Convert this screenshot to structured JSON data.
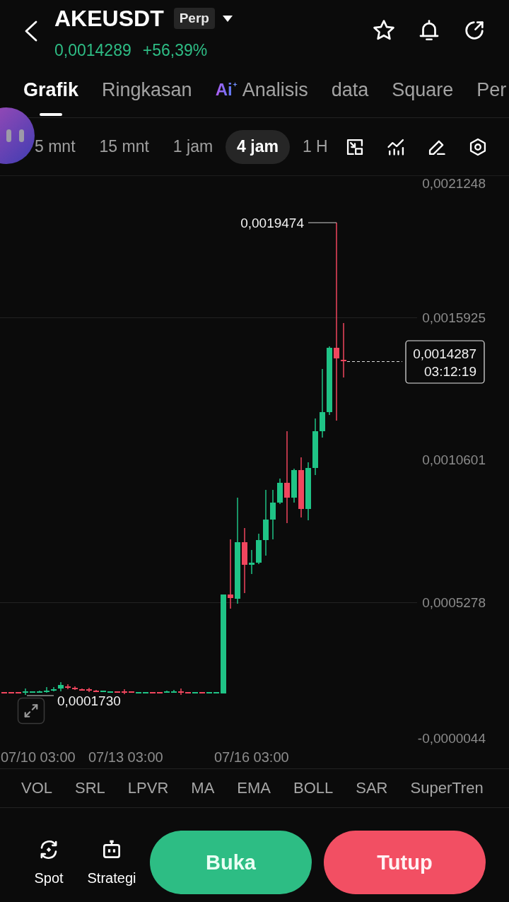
{
  "header": {
    "symbol": "AKEUSDT",
    "badge": "Perp",
    "price": "0,0014289",
    "change": "+56,39%"
  },
  "tabs": [
    {
      "label": "Grafik",
      "selected": true
    },
    {
      "label": "Ringkasan",
      "selected": false
    },
    {
      "label": "Analisis",
      "badge": "Ai",
      "selected": false
    },
    {
      "label": "data",
      "selected": false
    },
    {
      "label": "Square",
      "selected": false
    },
    {
      "label": "Per",
      "selected": false
    }
  ],
  "intervals": [
    {
      "label": "5 mnt",
      "selected": false
    },
    {
      "label": "15 mnt",
      "selected": false
    },
    {
      "label": "1 jam",
      "selected": false
    },
    {
      "label": "4 jam",
      "selected": true
    },
    {
      "label": "1 H",
      "selected": false
    }
  ],
  "chart": {
    "y_axis_labels": [
      "0,0021248",
      "0,0015925",
      "0,0010601",
      "0,0005278",
      "-0,0000044"
    ],
    "x_axis_labels": [
      "07/10 03:00",
      "07/13 03:00",
      "07/16 03:00"
    ],
    "high_label": "0,0019474",
    "low_label": "0,0001730",
    "price_tag": {
      "price": "0,0014287",
      "countdown": "03:12:19"
    }
  },
  "indicators": [
    "VOL",
    "SRL",
    "LPVR",
    "MA",
    "EMA",
    "BOLL",
    "SAR",
    "SuperTren"
  ],
  "side_actions": [
    {
      "label": "Spot",
      "kind": "spot"
    },
    {
      "label": "Strategi",
      "kind": "bot"
    }
  ],
  "trade_buttons": [
    {
      "label": "Buka",
      "kind": "open"
    },
    {
      "label": "Tutup",
      "kind": "close"
    }
  ]
}
